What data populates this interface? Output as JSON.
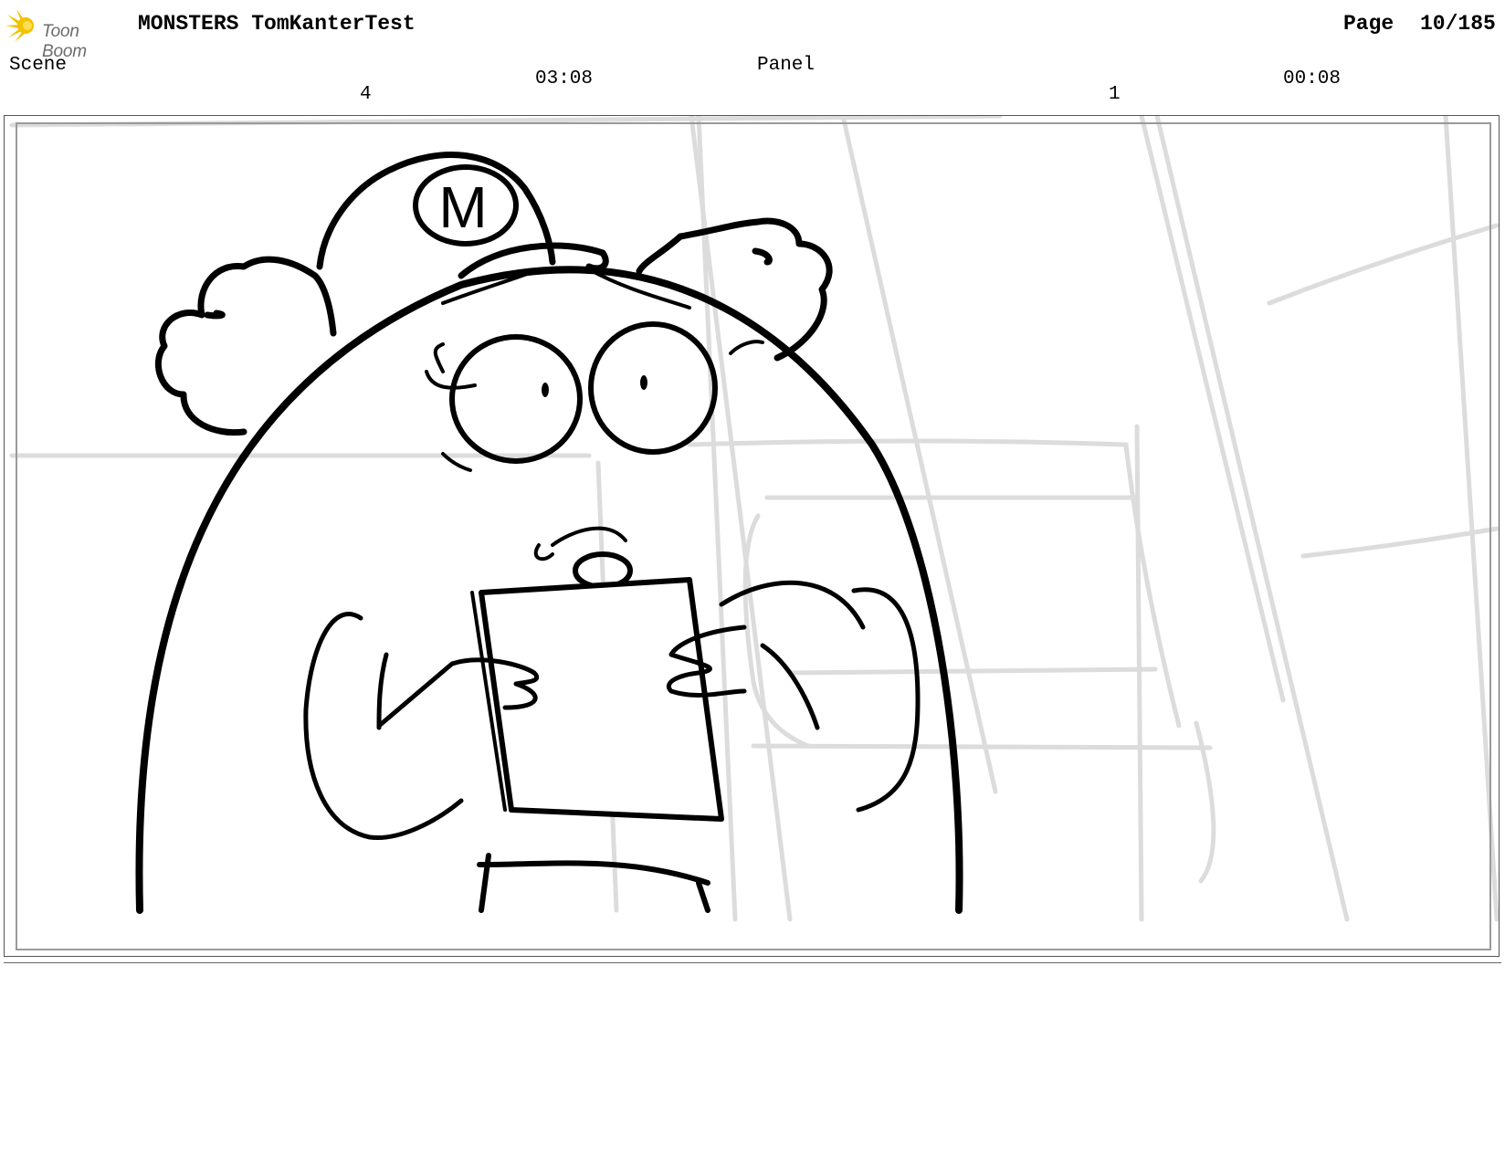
{
  "header": {
    "logo_text": "Toon Boom",
    "project_title": "MONSTERS TomKanterTest",
    "page_label": "Page",
    "page_value": "10/185"
  },
  "info": {
    "scene_label": "Scene",
    "scene_value": "4",
    "scene_duration": "03:08",
    "panel_label": "Panel",
    "panel_value": "1",
    "panel_duration": "00:08"
  },
  "panel": {
    "cap_letter": "M",
    "icon": "storyboard-sketch-image"
  },
  "colors": {
    "logo_accent": "#f2c200",
    "line_art": "#000000",
    "background_sketch": "#dcdcdc",
    "frame_border": "#555555"
  }
}
